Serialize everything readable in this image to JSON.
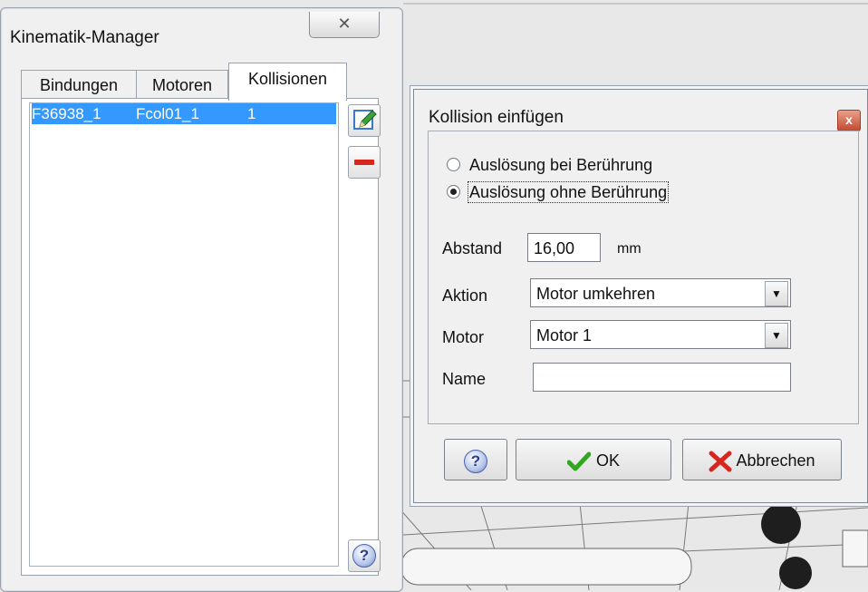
{
  "manager": {
    "title": "Kinematik-Manager",
    "close_glyph": "✕",
    "tabs": [
      {
        "label": "Bindungen"
      },
      {
        "label": "Motoren"
      },
      {
        "label": "Kollisionen"
      }
    ],
    "active_tab": "Kollisionen",
    "list_row": {
      "col1": "F36938_1",
      "col2": "Fcol01_1",
      "col3": "1"
    },
    "edit_icon": "pencil-icon",
    "remove_icon": "minus-icon",
    "help_icon": "help-icon",
    "help_glyph": "?"
  },
  "dialog": {
    "title": "Kollision einfügen",
    "close_glyph": "x",
    "radio_touch": "Auslösung bei Berührung",
    "radio_no_touch": "Auslösung ohne Berührung",
    "selected_radio": "Auslösung ohne Berührung",
    "distance_label": "Abstand",
    "distance_value": "16,00",
    "distance_unit": "mm",
    "action_label": "Aktion",
    "action_value": "Motor umkehren",
    "motor_label": "Motor",
    "motor_value": "Motor 1",
    "name_label": "Name",
    "name_value": "",
    "help_glyph": "?",
    "ok_label": "OK",
    "cancel_label": "Abbrechen",
    "combo_arrow": "▼",
    "colors": {
      "selection": "#3399ff",
      "ok_check": "#2fa71f",
      "cancel_x": "#d8261c"
    }
  }
}
